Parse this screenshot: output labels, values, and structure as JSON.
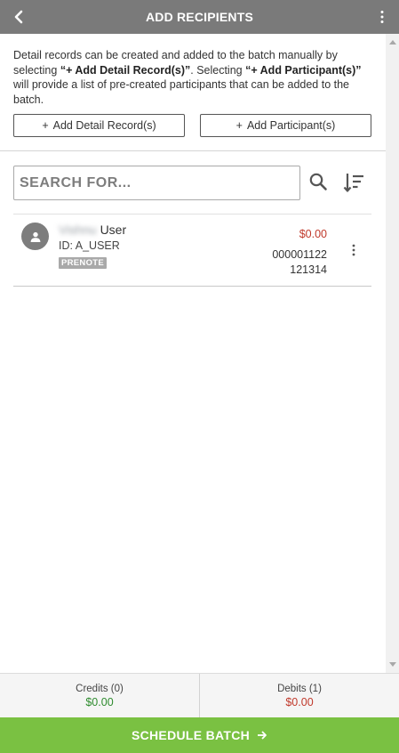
{
  "header": {
    "title": "ADD RECIPIENTS",
    "back_icon": "chevron-left-icon",
    "menu_icon": "more-vertical-icon"
  },
  "intro": {
    "part1": "Detail records can be created and added to the batch manually by selecting ",
    "bold1": "“+ Add Detail Record(s)”",
    "part2": ". Selecting ",
    "bold2": "“+ Add Participant(s)”",
    "part3": " will provide a list of pre-created participants that can be added to the batch."
  },
  "buttons": {
    "add_detail_plus": "+",
    "add_detail": "Add Detail Record(s)",
    "add_participant_plus": "+",
    "add_participant": "Add Participant(s)"
  },
  "search": {
    "placeholder": "SEARCH FOR...",
    "value": "",
    "search_icon": "search-icon",
    "sort_icon": "sort-icon"
  },
  "recipients": [
    {
      "first_name_blurred": "Vishnu",
      "last_name": "User",
      "id_text": "ID: A_USER",
      "badge": "PRENOTE",
      "amount": "$0.00",
      "account": "000001122",
      "routing": "121314"
    }
  ],
  "totals": {
    "credits_label": "Credits (0)",
    "credits_value": "$0.00",
    "debits_label": "Debits (1)",
    "debits_value": "$0.00"
  },
  "footer": {
    "schedule_label": "SCHEDULE BATCH"
  },
  "colors": {
    "header_bg": "#7a7a7a",
    "accent_green": "#7ac142",
    "debit_red": "#c0392b",
    "credit_green": "#2e8b2e"
  }
}
